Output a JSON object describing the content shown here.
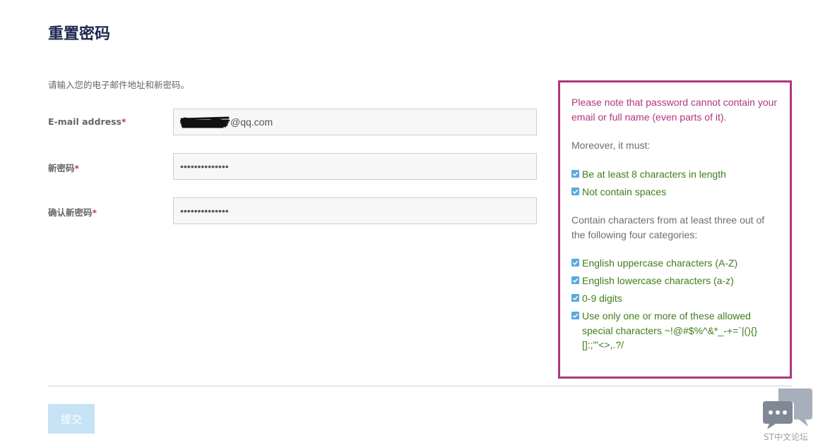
{
  "page": {
    "title": "重置密码",
    "instructions": "请输入您的电子邮件地址和新密码。"
  },
  "form": {
    "email": {
      "label": "E-mail address",
      "required_mark": "*",
      "value": "@qq.com"
    },
    "new_password": {
      "label": "新密码",
      "required_mark": "*",
      "value": "••••••••••••••"
    },
    "confirm_password": {
      "label": "确认新密码",
      "required_mark": "*",
      "value": "••••••••••••••"
    },
    "submit_label": "提交"
  },
  "password_rules": {
    "warning": "Please note that password cannot contain your email or full name (even parts of it).",
    "moreover": "Moreover, it must:",
    "basic_rules": [
      "Be at least 8 characters in length",
      "Not contain spaces"
    ],
    "categories_intro": "Contain characters from at least three out of the following four categories:",
    "category_rules": [
      "English uppercase characters (A-Z)",
      "English lowercase characters (a-z)",
      "0-9 digits",
      "Use only one or more of these allowed special characters ~!@#$%^&*_-+=`|(){}[]:;\"'<>,.?/"
    ]
  },
  "watermark": {
    "text": "ST中文论坛",
    "icon": "chat-bubbles-icon"
  },
  "colors": {
    "title": "#1b2a4e",
    "rules_border": "#b0357e",
    "rule_ok": "#3f7d1a",
    "check": "#5aa9dd",
    "submit_bg": "#c6e3f5",
    "required": "#c8385f"
  }
}
